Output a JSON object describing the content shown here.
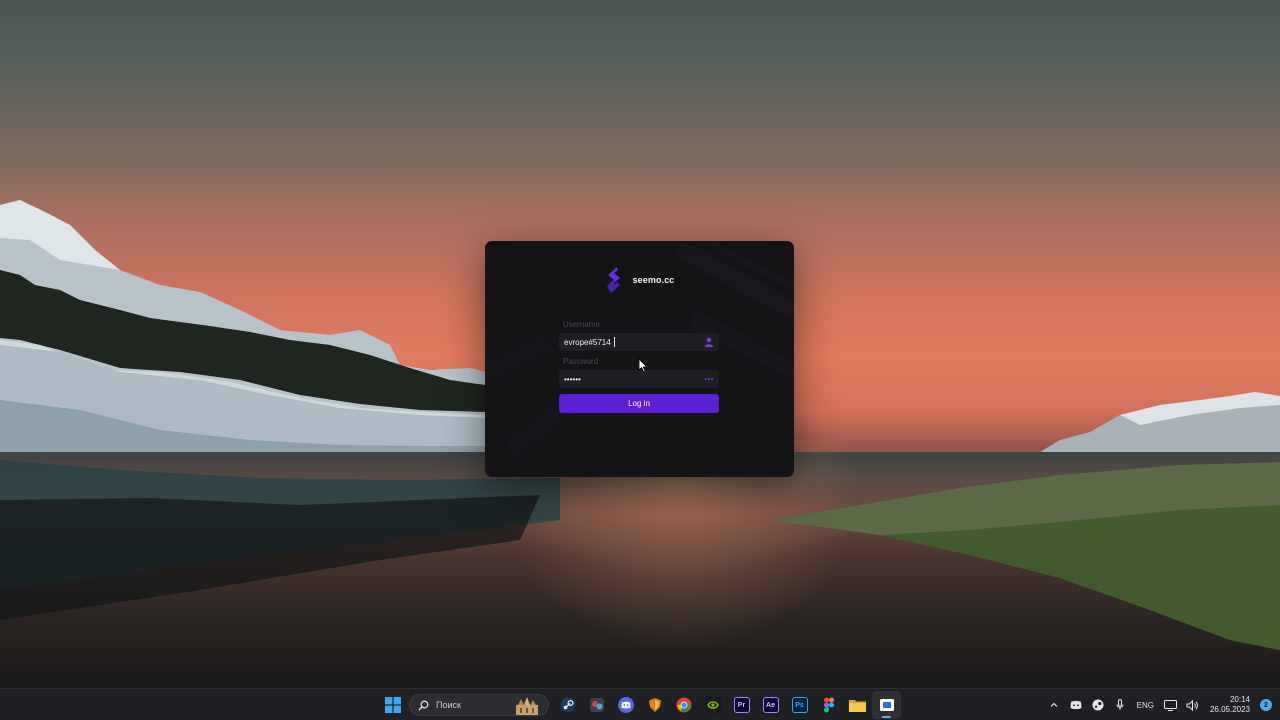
{
  "login": {
    "brand_name": "seemo.cc",
    "username_label": "Username",
    "username_value": "evrope#5714",
    "password_label": "Password",
    "password_value": "••••••",
    "login_button": "Log in",
    "accent_color": "#5a1fd6"
  },
  "taskbar": {
    "search_placeholder": "Поиск",
    "apps": [
      "windows-start-icon",
      "steam-icon",
      "game-launcher-icon",
      "discord-icon",
      "shield-app-icon",
      "chrome-icon",
      "nvidia-icon",
      "premiere-pro-icon",
      "after-effects-icon",
      "photoshop-icon",
      "figma-icon",
      "file-explorer-icon",
      "active-app-icon"
    ],
    "app_labels": {
      "premiere": "Pr",
      "after_effects": "Ae",
      "photoshop": "Ps"
    },
    "language": "ENG",
    "time": "20:14",
    "date": "26.05.2023",
    "notification_count": "2"
  }
}
